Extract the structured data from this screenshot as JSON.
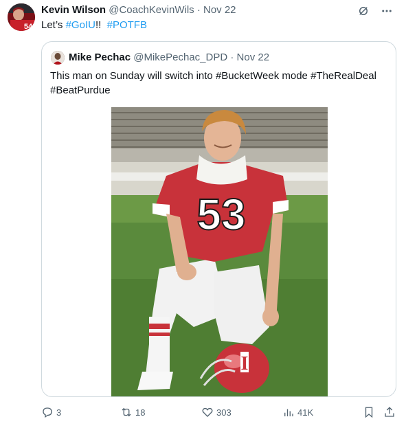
{
  "tweet": {
    "author_name": "Kevin Wilson",
    "author_handle": "@CoachKevinWils",
    "separator": "·",
    "date": "Nov 22",
    "text_prefix": "Let’s ",
    "hashtag1": "#GoIU",
    "text_mid": "!!  ",
    "hashtag2": "#POTFB",
    "avatar_jersey_number": "54"
  },
  "quote": {
    "author_name": "Mike Pechac",
    "author_handle": "@MikePechac_DPD",
    "separator": "·",
    "date": "Nov 22",
    "text": "This man on Sunday will switch into #BucketWeek mode #TheRealDeal #BeatPurdue",
    "photo": {
      "jersey_number": "53",
      "helmet_letter": "I"
    }
  },
  "actions": {
    "replies": "3",
    "reposts": "18",
    "likes": "303",
    "views": "41K"
  },
  "icons": {
    "top": [
      "grok-icon",
      "more-icon"
    ],
    "actions": [
      "reply-icon",
      "repost-icon",
      "like-icon",
      "views-icon",
      "bookmark-icon",
      "share-icon"
    ]
  },
  "colors": {
    "link": "#1d9bf0",
    "muted": "#536471",
    "border": "#cfd9de",
    "jersey_red": "#c8323a"
  }
}
